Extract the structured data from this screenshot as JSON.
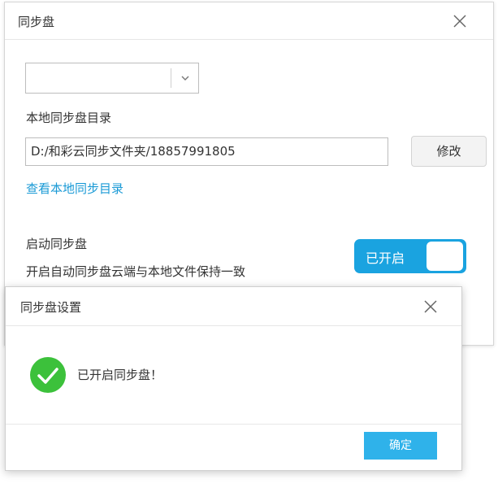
{
  "main_dialog": {
    "title": "同步盘",
    "close_icon": "close-icon",
    "dropdown": {
      "selected_value": "",
      "chevron_icon": "chevron-down-icon"
    },
    "dir_label": "本地同步盘目录",
    "path_value": "D:/和彩云同步文件夹/18857991805",
    "modify_button": "修改",
    "view_link": "查看本地同步目录",
    "sync_label": "启动同步盘",
    "sync_desc": "开启自动同步盘云端与本地文件保持一致",
    "toggle": {
      "label": "已开启",
      "on": true
    }
  },
  "sub_dialog": {
    "title": "同步盘设置",
    "close_icon": "close-icon",
    "status_icon": "check-circle-icon",
    "message": "已开启同步盘！",
    "ok_button": "确定"
  },
  "colors": {
    "accent": "#1aa3e0",
    "ok_button": "#2fb2ea",
    "link": "#1a9ad6",
    "success": "#3cc13b"
  }
}
